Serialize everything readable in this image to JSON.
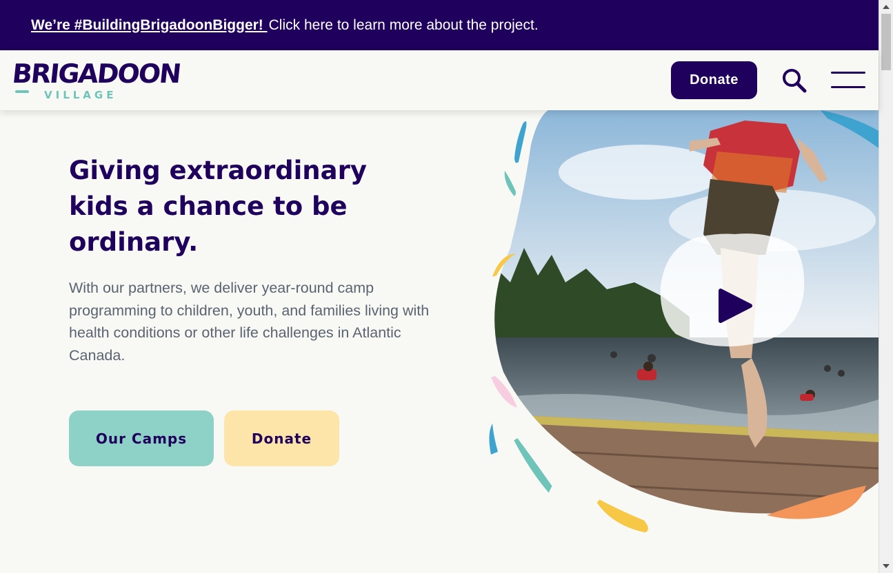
{
  "announcement": {
    "link_text": "We’re #BuildingBrigadoonBigger! ",
    "text": "Click here to learn more about the project."
  },
  "header": {
    "logo_word": "BRIGADOON",
    "logo_sub": "VILLAGE",
    "donate_label": "Donate"
  },
  "hero": {
    "title": "Giving extraordinary kids a chance to be ordinary.",
    "description": "With our partners, we deliver year-round camp programming to children, youth, and families living with health conditions or other life challenges in Atlantic Canada.",
    "btn_camps": "Our Camps",
    "btn_donate": "Donate"
  },
  "colors": {
    "brand": "#1f005c",
    "teal": "#8dd1c7",
    "yellow": "#fde5a9",
    "orange": "#f4955a"
  },
  "icons": [
    "search-icon",
    "hamburger-menu-icon",
    "play-icon"
  ]
}
